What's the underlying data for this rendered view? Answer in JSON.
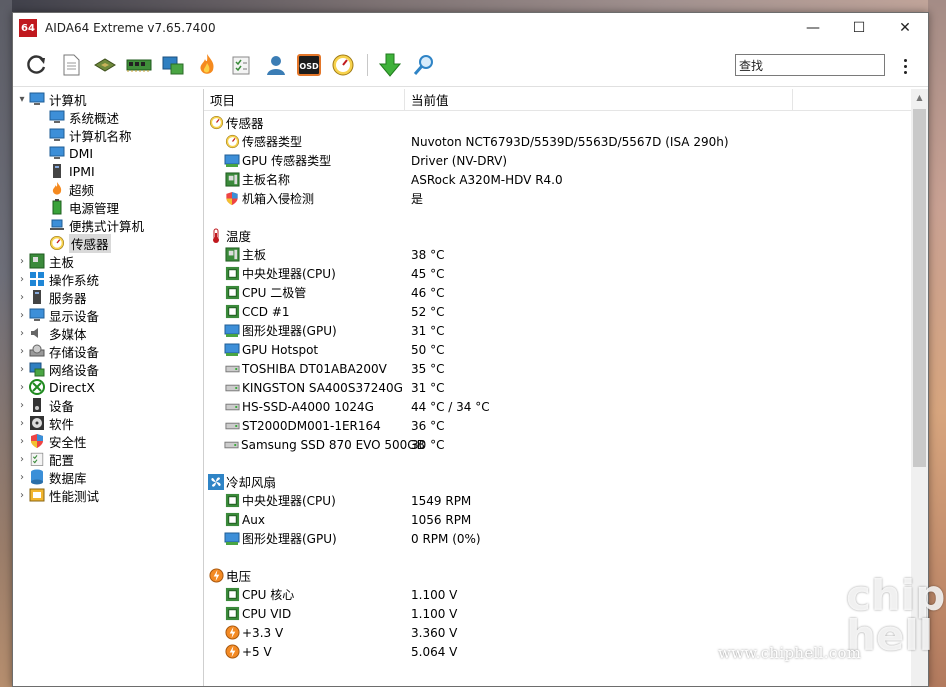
{
  "window": {
    "app_logo_text": "64",
    "title": "AIDA64 Extreme v7.65.7400",
    "controls": {
      "minimize": "—",
      "maximize": "☐",
      "close": "✕"
    }
  },
  "toolbar": {
    "search_value": "查找"
  },
  "tree": {
    "computer": {
      "label": "计算机",
      "children": [
        "系统概述",
        "计算机名称",
        "DMI",
        "IPMI",
        "超频",
        "电源管理",
        "便携式计算机",
        "传感器"
      ]
    },
    "roots": [
      "主板",
      "操作系统",
      "服务器",
      "显示设备",
      "多媒体",
      "存储设备",
      "网络设备",
      "DirectX",
      "设备",
      "软件",
      "安全性",
      "配置",
      "数据库",
      "性能测试"
    ]
  },
  "grid": {
    "headers": {
      "item": "项目",
      "value": "当前值"
    },
    "groups": {
      "sensor": {
        "title": "传感器",
        "rows": [
          {
            "name": "传感器类型",
            "value": "Nuvoton NCT6793D/5539D/5563D/5567D  (ISA 290h)"
          },
          {
            "name": "GPU 传感器类型",
            "value": "Driver  (NV-DRV)"
          },
          {
            "name": "主板名称",
            "value": "ASRock A320M-HDV R4.0"
          },
          {
            "name": "机箱入侵检测",
            "value": "是"
          }
        ]
      },
      "temp": {
        "title": "温度",
        "rows": [
          {
            "name": "主板",
            "value": "38 °C"
          },
          {
            "name": "中央处理器(CPU)",
            "value": "45 °C"
          },
          {
            "name": "CPU 二极管",
            "value": "46 °C"
          },
          {
            "name": "CCD #1",
            "value": "52 °C"
          },
          {
            "name": "图形处理器(GPU)",
            "value": "31 °C"
          },
          {
            "name": "GPU Hotspot",
            "value": "50 °C"
          },
          {
            "name": "TOSHIBA DT01ABA200V",
            "value": "35 °C"
          },
          {
            "name": "KINGSTON SA400S37240G",
            "value": "31 °C"
          },
          {
            "name": "HS-SSD-A4000 1024G",
            "value": "44 °C / 34 °C"
          },
          {
            "name": "ST2000DM001-1ER164",
            "value": "36 °C"
          },
          {
            "name": "Samsung SSD 870 EVO 500GB",
            "value": "30 °C"
          }
        ]
      },
      "fan": {
        "title": "冷却风扇",
        "rows": [
          {
            "name": "中央处理器(CPU)",
            "value": "1549 RPM"
          },
          {
            "name": "Aux",
            "value": "1056 RPM"
          },
          {
            "name": "图形处理器(GPU)",
            "value": "0 RPM  (0%)"
          }
        ]
      },
      "volt": {
        "title": "电压",
        "rows": [
          {
            "name": "CPU 核心",
            "value": "1.100 V"
          },
          {
            "name": "CPU VID",
            "value": "1.100 V"
          },
          {
            "name": "+3.3 V",
            "value": "3.360 V"
          },
          {
            "name": "+5 V",
            "value": "5.064 V"
          }
        ]
      }
    }
  },
  "watermark": {
    "url": "www.chiphell.com",
    "logo": "chip hell"
  }
}
